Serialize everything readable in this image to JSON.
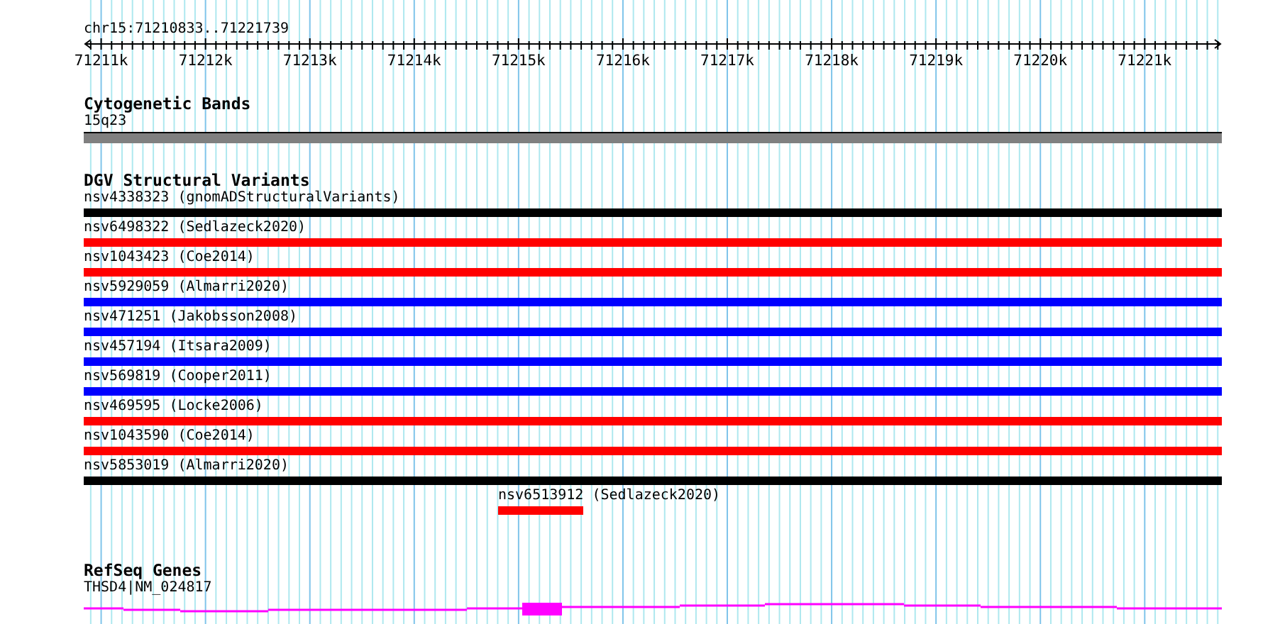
{
  "ruler": {
    "region": "chr15:71210833..71221739",
    "ticks": [
      "71211k",
      "71212k",
      "71213k",
      "71214k",
      "71215k",
      "71216k",
      "71217k",
      "71218k",
      "71219k",
      "71220k",
      "71221k"
    ]
  },
  "tracks": [
    {
      "kind": "bands",
      "title": "Cytogenetic Bands",
      "features": [
        {
          "label": "15q23",
          "color": "#808080"
        }
      ]
    },
    {
      "kind": "variants",
      "title": "DGV Structural Variants",
      "features": [
        {
          "label": "nsv4338323 (gnomADStructuralVariants)",
          "color": "#000000",
          "kind": "full"
        },
        {
          "label": "nsv6498322 (Sedlazeck2020)",
          "color": "#ff0000",
          "kind": "full"
        },
        {
          "label": "nsv1043423 (Coe2014)",
          "color": "#ff0000",
          "kind": "full"
        },
        {
          "label": "nsv5929059 (Almarri2020)",
          "color": "#0000ff",
          "kind": "full"
        },
        {
          "label": "nsv471251 (Jakobsson2008)",
          "color": "#0000ff",
          "kind": "full"
        },
        {
          "label": "nsv457194 (Itsara2009)",
          "color": "#0000ff",
          "kind": "full"
        },
        {
          "label": "nsv569819 (Cooper2011)",
          "color": "#0000ff",
          "kind": "full"
        },
        {
          "label": "nsv469595 (Locke2006)",
          "color": "#ff0000",
          "kind": "full"
        },
        {
          "label": "nsv1043590 (Coe2014)",
          "color": "#ff0000",
          "kind": "full"
        },
        {
          "label": "nsv5853019 (Almarri2020)",
          "color": "#000000",
          "kind": "full"
        },
        {
          "label": "nsv6513912 (Sedlazeck2020)",
          "color": "#ff0000",
          "kind": "partial"
        }
      ]
    },
    {
      "kind": "genes",
      "title": "RefSeq Genes",
      "features": [
        {
          "label": "THSD4|NM_024817",
          "color": "#ff00ff"
        }
      ]
    }
  ]
}
